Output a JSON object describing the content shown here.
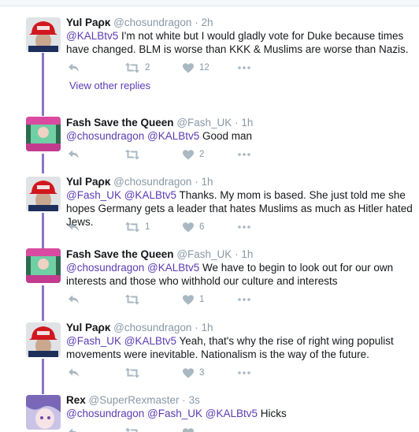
{
  "tweets": [
    {
      "author": "Yul Ρaρκ",
      "handle": "@chosundragon",
      "time": "2h",
      "mentions": "@KALBtv5",
      "body": "I'm not white but I would gladly vote for Duke because times have changed. BLM is worse than KKK & Muslims are worse than Nazis.",
      "counts": {
        "reply": "",
        "retweet": "2",
        "like": "12"
      }
    },
    {
      "author": "Fash Save the Queen",
      "handle": "@Fash_UK",
      "time": "1h",
      "mentions": "@chosundragon @KALBtv5",
      "body": "Good man",
      "counts": {
        "reply": "",
        "retweet": "",
        "like": "2"
      }
    },
    {
      "author": "Yul Ρaρκ",
      "handle": "@chosundragon",
      "time": "1h",
      "mentions": "@Fash_UK @KALBtv5",
      "body": "Thanks. My mom is based. She just told me she hopes Germany gets a leader that hates Muslims as much as Hitler hated Jews.",
      "counts": {
        "reply": "",
        "retweet": "1",
        "like": "6"
      }
    },
    {
      "author": "Fash Save the Queen",
      "handle": "@Fash_UK",
      "time": "1h",
      "mentions": "@chosundragon @KALBtv5",
      "body": "We have to begin to look out for our own interests and those who withhold our culture and interests",
      "counts": {
        "reply": "",
        "retweet": "",
        "like": "1"
      }
    },
    {
      "author": "Yul Ρaρκ",
      "handle": "@chosundragon",
      "time": "1h",
      "mentions": "@Fash_UK @KALBtv5",
      "body": "Yeah, that's why the rise of right wing populist movements were inevitable. Nationalism is the way of the future.",
      "counts": {
        "reply": "",
        "retweet": "",
        "like": "3"
      }
    },
    {
      "author": "Rex",
      "handle": "@SuperRexmaster",
      "time": "3s",
      "mentions": "@chosundragon @Fash_UK @KALBtv5",
      "body": "Hicks",
      "counts": {
        "reply": "",
        "retweet": "",
        "like": ""
      }
    }
  ],
  "view_other_replies": "View other replies",
  "separator": "·",
  "colors": {
    "thread_line": "#8d74c8",
    "link": "#5b3bb2",
    "icon": "#aab8c2"
  }
}
